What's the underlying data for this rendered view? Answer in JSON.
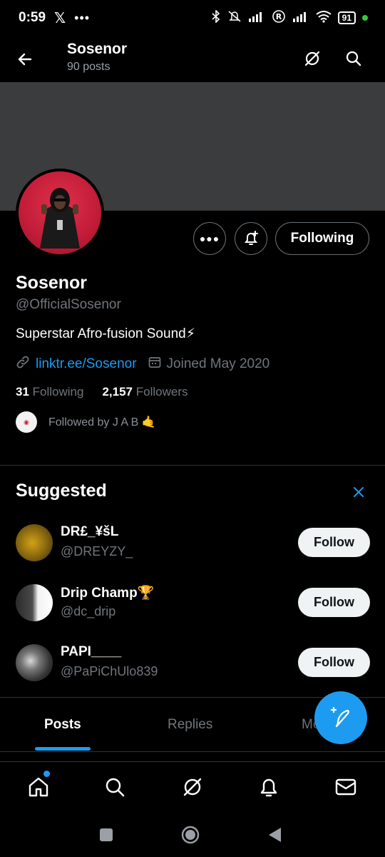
{
  "status_bar": {
    "time": "0:59",
    "app_icons": [
      "x-logo-icon",
      "more-dots-icon"
    ],
    "battery": "91",
    "indicators": [
      "bluetooth-icon",
      "mute-icon",
      "signal-icon",
      "registered-icon",
      "signal-icon",
      "wifi-icon"
    ]
  },
  "header": {
    "name": "Sosenor",
    "post_count": "90 posts"
  },
  "profile": {
    "name": "Sosenor",
    "handle": "@OfficialSosenor",
    "bio": "Superstar Afro-fusion Sound⚡",
    "link": "linktr.ee/Sosenor",
    "joined": "Joined May 2020",
    "following_count": "31",
    "following_label": "Following",
    "followers_count": "2,157",
    "followers_label": "Followers",
    "followed_by": "Followed by J A B 🤙",
    "following_button": "Following"
  },
  "suggested": {
    "title": "Suggested",
    "users": [
      {
        "name": "DR£_¥šL",
        "handle": "@DREYZY_",
        "button": "Follow"
      },
      {
        "name": "Drip Champ🏆",
        "handle": "@dc_drip",
        "button": "Follow"
      },
      {
        "name": "PAPI____",
        "handle": "@PaPiChUlo839",
        "button": "Follow"
      }
    ]
  },
  "tabs": [
    {
      "label": "Posts",
      "active": true
    },
    {
      "label": "Replies",
      "active": false
    },
    {
      "label": "Me",
      "active": false
    }
  ],
  "bottom_nav": [
    "home-icon",
    "search-icon",
    "grok-icon",
    "notifications-icon",
    "messages-icon"
  ],
  "colors": {
    "accent": "#1d9bf0",
    "background": "#000000",
    "banner": "#3a3c3e",
    "avatar_bg": "#c41e3a"
  }
}
